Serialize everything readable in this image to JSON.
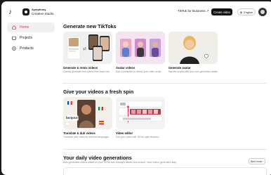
{
  "topbar": {
    "logo_icon": "tiktok-logo-icon",
    "brand_line1": "Symphony",
    "brand_line2": "Creative Studio",
    "tiktok_for_business": "TikTok for Business ↗",
    "create_video": "Create video",
    "language": "English"
  },
  "sidebar": {
    "items": [
      {
        "label": "Home",
        "icon": "home-icon",
        "active": true
      },
      {
        "label": "Projects",
        "icon": "folder-icon",
        "active": false
      },
      {
        "label": "Products",
        "icon": "box-icon",
        "active": false
      }
    ]
  },
  "sections": {
    "generate": {
      "title": "Generate new TikToks",
      "cards": [
        {
          "title": "Generate & remix videos",
          "desc": "Quickly generate new videos from base info"
        },
        {
          "title": "Avatar videos",
          "desc": "Add a presenter to deliver your video script"
        },
        {
          "title": "Generate avatar",
          "desc": "Narrate scripts with your own generated avatar"
        }
      ]
    },
    "spin": {
      "title": "Give your videos a fresh spin",
      "cards": [
        {
          "title": "Translate & dub videos",
          "desc": "Translate your video for different languages",
          "overlay_word": "bonjour!"
        },
        {
          "title": "Video editor",
          "desc": "Edit your video with TikTok-style features"
        }
      ]
    },
    "daily": {
      "title": "Your daily video generations",
      "desc": "Auto-generated videos based on your TikTok Ads Manager assets and actions. View videos generated daily.",
      "see_more": "See more"
    }
  },
  "colors": {
    "accent": "#fe2c55",
    "dark": "#111111"
  }
}
